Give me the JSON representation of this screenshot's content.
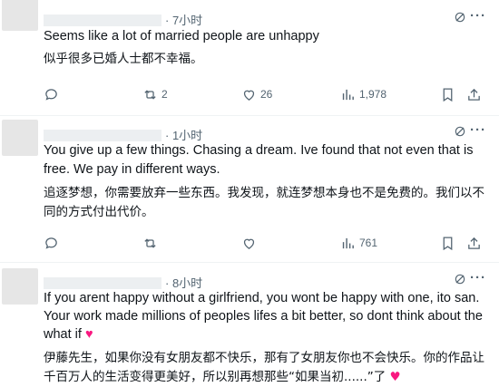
{
  "tweets": [
    {
      "time": "· 7小时",
      "text_en": "Seems like a lot of married people are unhappy",
      "text_zh": "似乎很多已婚人士都不幸福。",
      "replies": "",
      "retweets": "2",
      "likes": "26",
      "views": "1,978"
    },
    {
      "time": "· 1小时",
      "text_en": "You give up a few things. Chasing a dream. Ive found that not even that is free. We pay in different ways.",
      "text_zh": "追逐梦想，你需要放弃一些东西。我发现，就连梦想本身也不是免费的。我们以不同的方式付出代价。",
      "replies": "",
      "retweets": "",
      "likes": "",
      "views": "761"
    },
    {
      "time": "· 8小时",
      "text_en": "If you arent happy without a girlfriend, you wont be happy with one, ito san. Your work made millions of peoples lifes a bit better, so dont think about the what if",
      "text_zh": "伊藤先生，如果你没有女朋友都不快乐，那有了女朋友你也不会快乐。你的作品让千百万人的生活变得更美好，所以别再想那些“如果当初......”了"
    }
  ],
  "icons": {
    "grok": "grok-icon",
    "more": "more-icon",
    "reply": "reply-icon",
    "retweet": "retweet-icon",
    "like": "heart-icon",
    "views": "views-icon",
    "bookmark": "bookmark-icon",
    "share": "share-icon"
  },
  "colors": {
    "text": "#0f1419",
    "secondary": "#536471",
    "heart": "#f91880"
  }
}
